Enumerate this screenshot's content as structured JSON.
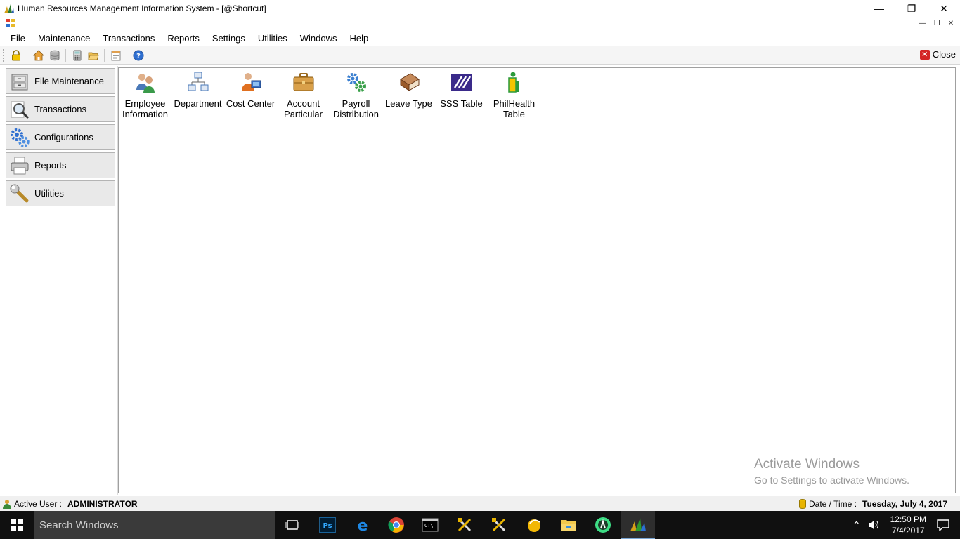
{
  "window": {
    "title": "Human Resources Management Information System - [@Shortcut]"
  },
  "menu": [
    "File",
    "Maintenance",
    "Transactions",
    "Reports",
    "Settings",
    "Utilities",
    "Windows",
    "Help"
  ],
  "toolbar": {
    "close_label": "Close"
  },
  "nav": [
    "File Maintenance",
    "Transactions",
    "Configurations",
    "Reports",
    "Utilities"
  ],
  "shortcuts": [
    {
      "line1": "Employee",
      "line2": "Information"
    },
    {
      "line1": "Department",
      "line2": ""
    },
    {
      "line1": "Cost Center",
      "line2": ""
    },
    {
      "line1": "Account",
      "line2": "Particular"
    },
    {
      "line1": "Payroll",
      "line2": "Distribution"
    },
    {
      "line1": "Leave Type",
      "line2": ""
    },
    {
      "line1": "SSS Table",
      "line2": ""
    },
    {
      "line1": "PhilHealth",
      "line2": "Table"
    }
  ],
  "watermark": {
    "line1": "Activate Windows",
    "line2": "Go to Settings to activate Windows."
  },
  "status": {
    "user_label": "Active User :",
    "user_value": "ADMINISTRATOR",
    "datetime_label": "Date / Time :",
    "datetime_value": "Tuesday, July 4, 2017"
  },
  "taskbar": {
    "search_placeholder": "Search Windows",
    "time": "12:50 PM",
    "date": "7/4/2017"
  }
}
